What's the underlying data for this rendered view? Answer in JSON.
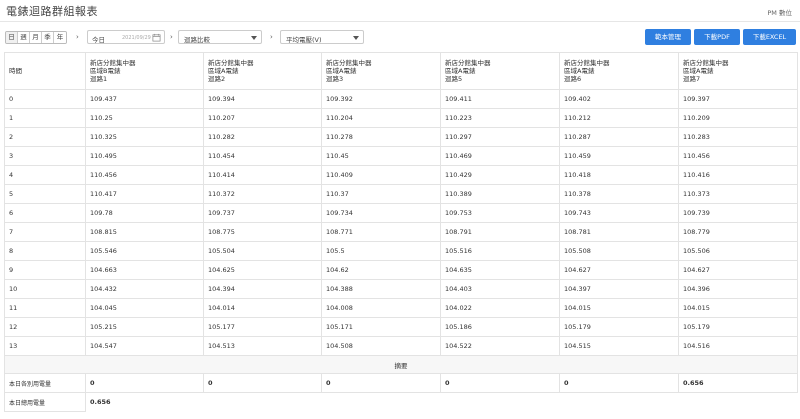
{
  "header": {
    "title": "電錶迴路群組報表",
    "user": "PM 數位"
  },
  "toolbar": {
    "periods": [
      "日",
      "週",
      "月",
      "季",
      "年"
    ],
    "active_period": 0,
    "date_label": "今日",
    "date_value": "2021/09/29",
    "compare_select": "迴路比較",
    "metric_select": "平均電壓(V)",
    "btn_template": "範本管理",
    "btn_pdf": "下載PDF",
    "btn_excel": "下載EXCEL"
  },
  "table": {
    "time_header": "時間",
    "columns": [
      {
        "line1": "新店分館集中器",
        "line2": "區域B電錶",
        "line3": "迴路1"
      },
      {
        "line1": "新店分館集中器",
        "line2": "區域A電錶",
        "line3": "迴路2"
      },
      {
        "line1": "新店分館集中器",
        "line2": "區域A電錶",
        "line3": "迴路3"
      },
      {
        "line1": "新店分館集中器",
        "line2": "區域A電錶",
        "line3": "迴路5"
      },
      {
        "line1": "新店分館集中器",
        "line2": "區域A電錶",
        "line3": "迴路6"
      },
      {
        "line1": "新店分館集中器",
        "line2": "區域A電錶",
        "line3": "迴路7"
      }
    ],
    "rows": [
      {
        "time": "0",
        "values": [
          "109.437",
          "109.394",
          "109.392",
          "109.411",
          "109.402",
          "109.397"
        ]
      },
      {
        "time": "1",
        "values": [
          "110.25",
          "110.207",
          "110.204",
          "110.223",
          "110.212",
          "110.209"
        ]
      },
      {
        "time": "2",
        "values": [
          "110.325",
          "110.282",
          "110.278",
          "110.297",
          "110.287",
          "110.283"
        ]
      },
      {
        "time": "3",
        "values": [
          "110.495",
          "110.454",
          "110.45",
          "110.469",
          "110.459",
          "110.456"
        ]
      },
      {
        "time": "4",
        "values": [
          "110.456",
          "110.414",
          "110.409",
          "110.429",
          "110.418",
          "110.416"
        ]
      },
      {
        "time": "5",
        "values": [
          "110.417",
          "110.372",
          "110.37",
          "110.389",
          "110.378",
          "110.373"
        ]
      },
      {
        "time": "6",
        "values": [
          "109.78",
          "109.737",
          "109.734",
          "109.753",
          "109.743",
          "109.739"
        ]
      },
      {
        "time": "7",
        "values": [
          "108.815",
          "108.775",
          "108.771",
          "108.791",
          "108.781",
          "108.779"
        ]
      },
      {
        "time": "8",
        "values": [
          "105.546",
          "105.504",
          "105.5",
          "105.516",
          "105.508",
          "105.506"
        ]
      },
      {
        "time": "9",
        "values": [
          "104.663",
          "104.625",
          "104.62",
          "104.635",
          "104.627",
          "104.627"
        ]
      },
      {
        "time": "10",
        "values": [
          "104.432",
          "104.394",
          "104.388",
          "104.403",
          "104.397",
          "104.396"
        ]
      },
      {
        "time": "11",
        "values": [
          "104.045",
          "104.014",
          "104.008",
          "104.022",
          "104.015",
          "104.015"
        ]
      },
      {
        "time": "12",
        "values": [
          "105.215",
          "105.177",
          "105.171",
          "105.186",
          "105.179",
          "105.179"
        ]
      },
      {
        "time": "13",
        "values": [
          "104.547",
          "104.513",
          "104.508",
          "104.522",
          "104.515",
          "104.516"
        ]
      }
    ],
    "summary_label": "摘要",
    "daily_each_label": "本日各別用電量",
    "daily_each_values": [
      "0",
      "0",
      "0",
      "0",
      "0",
      "0.656"
    ],
    "daily_total_label": "本日總用電量",
    "daily_total_value": "0.656"
  },
  "colors": {
    "accent": "#2f7fe0"
  }
}
